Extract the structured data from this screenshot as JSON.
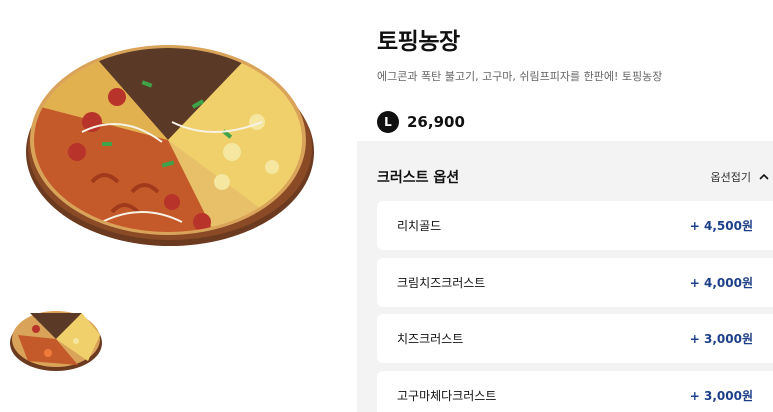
{
  "product": {
    "title": "토핑농장",
    "subtitle": "에그콘과 폭탄 불고기, 고구마, 쉬림프피자를 한판에! 토핑농장",
    "size_badge": "L",
    "price": "26,900"
  },
  "options": {
    "title": "크러스트 옵션",
    "collapse_label": "옵션접기",
    "items": [
      {
        "name": "리치골드",
        "price": "+ 4,500원"
      },
      {
        "name": "크림치즈크러스트",
        "price": "+ 4,000원"
      },
      {
        "name": "치즈크러스트",
        "price": "+ 3,000원"
      },
      {
        "name": "고구마체다크러스트",
        "price": "+ 3,000원"
      }
    ]
  },
  "colors": {
    "accent_price": "#1d3f8a",
    "panel_bg": "#f3f3f3"
  }
}
